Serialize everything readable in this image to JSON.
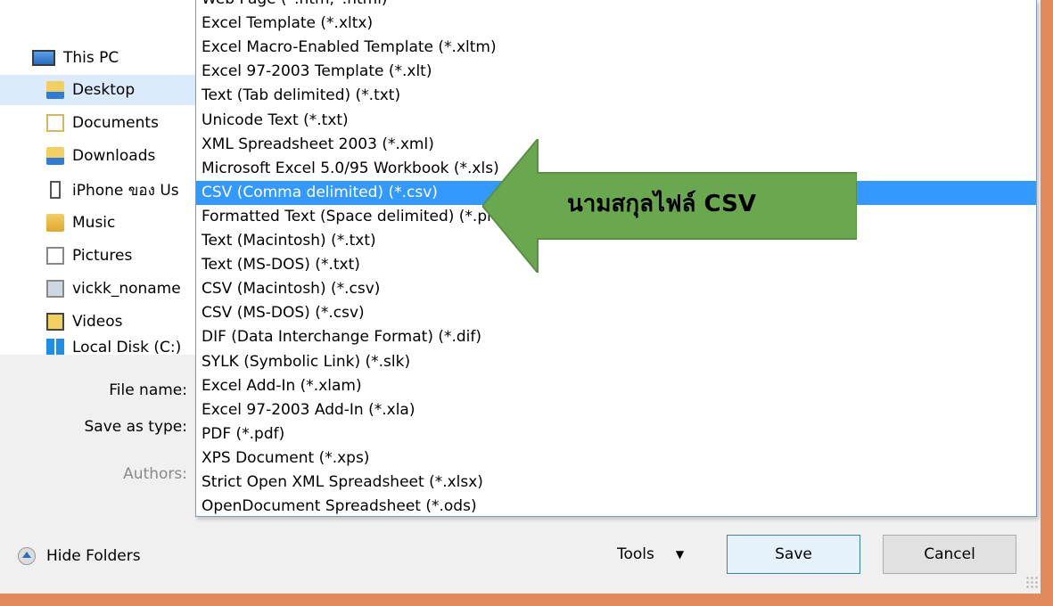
{
  "nav": {
    "items": [
      {
        "label": "This PC",
        "icon": "this-pc-icon"
      },
      {
        "label": "Desktop",
        "icon": "desktop-folder-icon"
      },
      {
        "label": "Documents",
        "icon": "documents-icon"
      },
      {
        "label": "Downloads",
        "icon": "downloads-folder-icon"
      },
      {
        "label": "iPhone ของ Us",
        "icon": "iphone-icon"
      },
      {
        "label": "Music",
        "icon": "music-folder-icon"
      },
      {
        "label": "Pictures",
        "icon": "pictures-icon"
      },
      {
        "label": "vickk_noname",
        "icon": "network-drive-icon"
      },
      {
        "label": "Videos",
        "icon": "videos-folder-icon"
      },
      {
        "label": "Local Disk (C:)",
        "icon": "local-disk-icon"
      }
    ],
    "selected": "Desktop"
  },
  "form": {
    "file_name_label": "File name:",
    "save_as_type_label": "Save as type:",
    "authors_label": "Authors:"
  },
  "type_options": [
    "Web Page (*.htm;*.html)",
    "Excel Template (*.xltx)",
    "Excel Macro-Enabled Template (*.xltm)",
    "Excel 97-2003 Template (*.xlt)",
    "Text (Tab delimited) (*.txt)",
    "Unicode Text (*.txt)",
    "XML Spreadsheet 2003 (*.xml)",
    "Microsoft Excel 5.0/95 Workbook (*.xls)",
    "CSV (Comma delimited) (*.csv)",
    "Formatted Text (Space delimited) (*.prn)",
    "Text (Macintosh) (*.txt)",
    "Text (MS-DOS) (*.txt)",
    "CSV (Macintosh) (*.csv)",
    "CSV (MS-DOS) (*.csv)",
    "DIF (Data Interchange Format) (*.dif)",
    "SYLK (Symbolic Link) (*.slk)",
    "Excel Add-In (*.xlam)",
    "Excel 97-2003 Add-In (*.xla)",
    "PDF (*.pdf)",
    "XPS Document (*.xps)",
    "Strict Open XML Spreadsheet (*.xlsx)",
    "OpenDocument Spreadsheet (*.ods)"
  ],
  "selected_option": "CSV (Comma delimited) (*.csv)",
  "callout": {
    "text": "นามสกุลไฟล์ CSV",
    "color": "#6aa84f"
  },
  "footer": {
    "hide_folders_label": "Hide Folders",
    "tools_label": "Tools",
    "save_label": "Save",
    "cancel_label": "Cancel"
  },
  "colors": {
    "selection": "#3399ff",
    "frame": "#e38a5a",
    "arrow": "#6aa84f"
  }
}
